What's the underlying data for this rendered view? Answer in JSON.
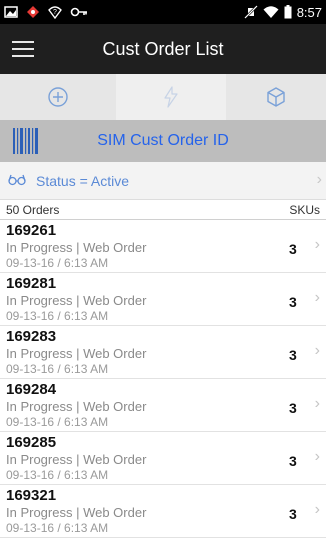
{
  "status_bar": {
    "time": "8:57",
    "left_icons": [
      "image-icon",
      "app-badge-icon",
      "help-icon",
      "key-icon"
    ],
    "right_icons": [
      "mute-icon",
      "wifi-icon",
      "battery-icon"
    ]
  },
  "app_bar": {
    "title": "Cust Order List",
    "menu_icon": "hamburger-icon"
  },
  "actions": [
    {
      "icon": "add-circle-icon"
    },
    {
      "icon": "lightning-icon"
    },
    {
      "icon": "cube-icon"
    }
  ],
  "scan": {
    "label": "SIM Cust Order ID",
    "icon": "barcode-icon"
  },
  "filter": {
    "text": "Status = Active",
    "icon": "glasses-icon"
  },
  "list_header": {
    "count_label": "50 Orders",
    "skus_label": "SKUs"
  },
  "orders": [
    {
      "id": "169261",
      "status": "In Progress | Web Order",
      "date": "09-13-16 / 6:13 AM",
      "skus": "3"
    },
    {
      "id": "169281",
      "status": "In Progress | Web Order",
      "date": "09-13-16 / 6:13 AM",
      "skus": "3"
    },
    {
      "id": "169283",
      "status": "In Progress | Web Order",
      "date": "09-13-16 / 6:13 AM",
      "skus": "3"
    },
    {
      "id": "169284",
      "status": "In Progress | Web Order",
      "date": "09-13-16 / 6:13 AM",
      "skus": "3"
    },
    {
      "id": "169285",
      "status": "In Progress | Web Order",
      "date": "09-13-16 / 6:13 AM",
      "skus": "3"
    },
    {
      "id": "169321",
      "status": "In Progress | Web Order",
      "date": "09-13-16 / 6:13 AM",
      "skus": "3"
    }
  ],
  "colors": {
    "app_bar": "#1f1f1f",
    "action_bar": "#e6e6e6",
    "scan_row": "#bdbdbd",
    "accent_blue": "#2563eb",
    "filter_blue": "#5b8ad6"
  }
}
